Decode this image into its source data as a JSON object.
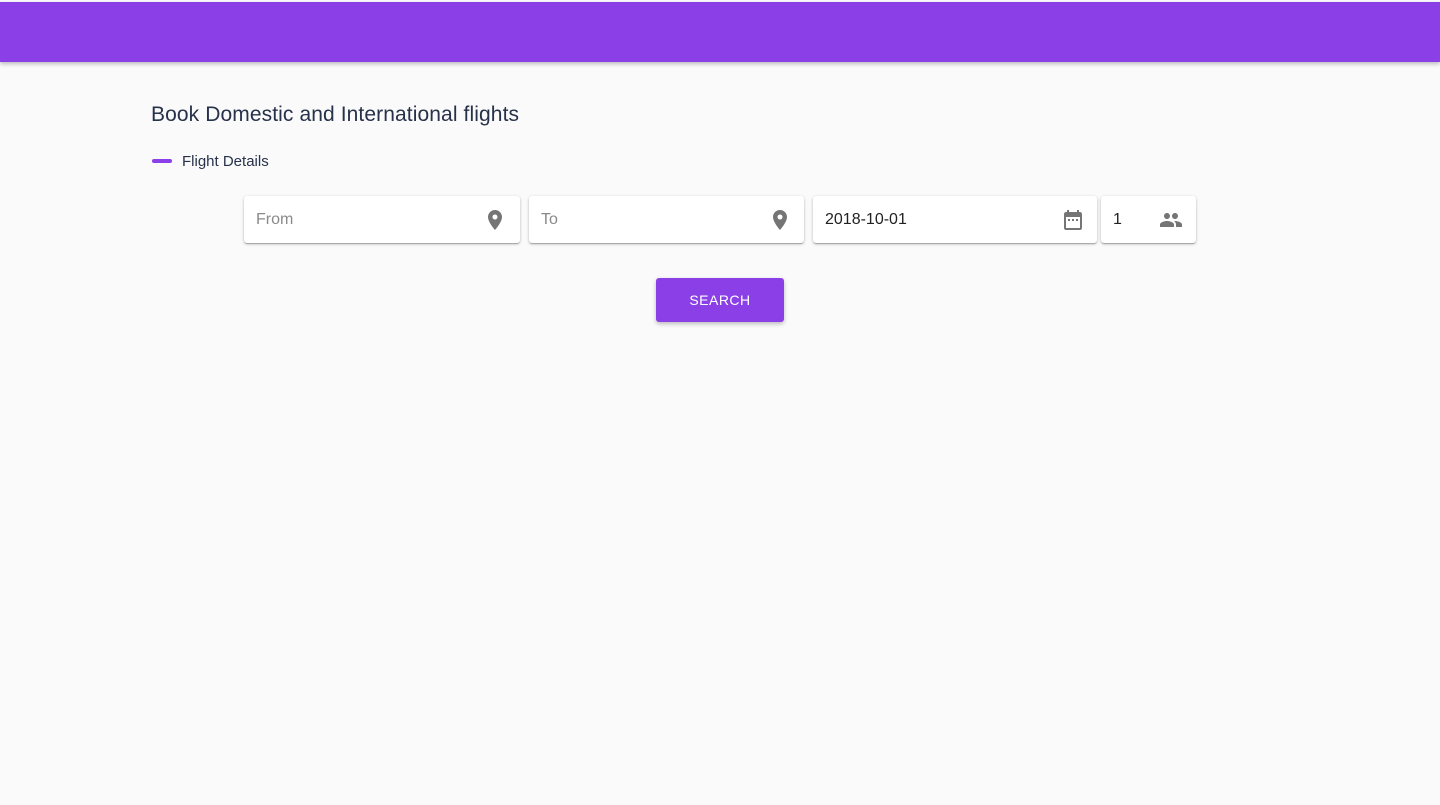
{
  "header": {
    "background_color": "#8a40e6"
  },
  "page": {
    "title": "Book Domestic and International flights",
    "section_label": "Flight Details"
  },
  "form": {
    "from": {
      "value": "",
      "placeholder": "From",
      "icon": "location-pin-icon"
    },
    "to": {
      "value": "",
      "placeholder": "To",
      "icon": "location-pin-icon"
    },
    "date": {
      "value": "2018-10-01",
      "icon": "calendar-icon"
    },
    "passengers": {
      "value": "1",
      "icon": "people-icon"
    },
    "search_label": "SEARCH"
  },
  "colors": {
    "accent": "#8a40e6",
    "background": "#fafafa",
    "heading_text": "#27324a",
    "icon": "#757575"
  }
}
